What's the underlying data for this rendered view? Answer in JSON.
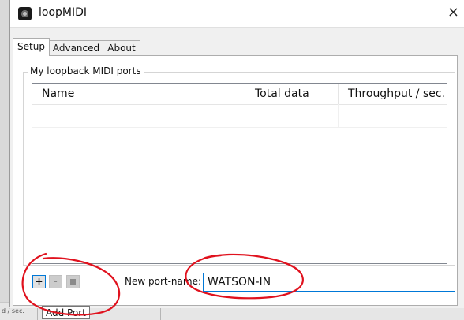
{
  "window": {
    "title": "loopMIDI",
    "icon": "loopmidi-app-icon",
    "close_icon": "close-icon",
    "close_glyph": "×"
  },
  "tabs": [
    {
      "label": "Setup",
      "active": true
    },
    {
      "label": "Advanced",
      "active": false
    },
    {
      "label": "About",
      "active": false
    }
  ],
  "ports_group": {
    "label": "My loopback MIDI ports",
    "columns": [
      "Name",
      "Total data",
      "Throughput / sec."
    ]
  },
  "controls": {
    "add_label": "+",
    "remove_label": "-",
    "new_port_label": "New port-name:",
    "new_port_value": "WATSON-IN"
  },
  "tooltip": {
    "text": "Add Port"
  },
  "background": {
    "left_fragment": "d / sec."
  },
  "colors": {
    "annotation": "#e0121e",
    "focus_blue": "#0078d7"
  }
}
